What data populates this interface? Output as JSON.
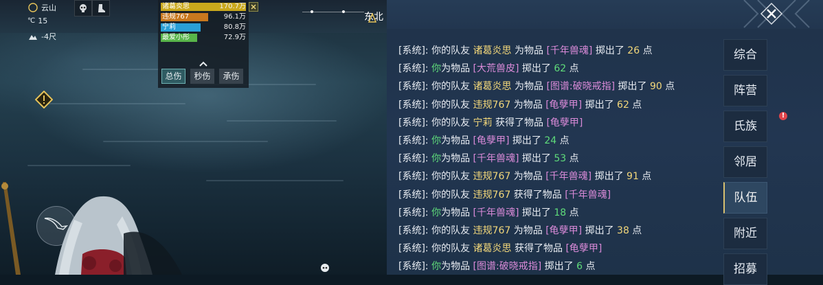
{
  "hud": {
    "weather": "云山",
    "temperature_unit": "℃",
    "temperature": "15",
    "altitude": "-4尺",
    "compass_label": "东北",
    "warning_icon": "warning-diamond-icon"
  },
  "damage_meter": {
    "entries": [
      {
        "name": "诸葛炎思",
        "value": "170.7万",
        "color": "#c9a81c",
        "fill": 1.0
      },
      {
        "name": "违规767",
        "value": "96.1万",
        "color": "#c9781e",
        "fill": 0.56
      },
      {
        "name": "宁莉",
        "value": "80.8万",
        "color": "#2a9fd6",
        "fill": 0.47
      },
      {
        "name": "最爱小彤",
        "value": "72.9万",
        "color": "#58b54a",
        "fill": 0.43
      }
    ],
    "tabs": [
      "总伤",
      "秒伤",
      "承伤"
    ],
    "active_tab": "总伤",
    "close_icon": "close-x-icon",
    "collapse_icon": "chevron-up-icon"
  },
  "chat": {
    "messages": [
      [
        {
          "t": "[系统]: ",
          "c": "sys"
        },
        {
          "t": "你的队友 ",
          "c": "sys"
        },
        {
          "t": "诸葛炎思",
          "c": "name"
        },
        {
          "t": " 为物品 ",
          "c": "sys"
        },
        {
          "t": "[千年兽魂]",
          "c": "item"
        },
        {
          "t": " 掷出了 ",
          "c": "sys"
        },
        {
          "t": "26",
          "c": "num"
        },
        {
          "t": " 点",
          "c": "sys"
        }
      ],
      [
        {
          "t": "[系统]: ",
          "c": "sys"
        },
        {
          "t": "你",
          "c": "you"
        },
        {
          "t": "为物品 ",
          "c": "sys"
        },
        {
          "t": "[大荒兽皮]",
          "c": "item"
        },
        {
          "t": " 掷出了 ",
          "c": "sys"
        },
        {
          "t": "62",
          "c": "you"
        },
        {
          "t": " 点",
          "c": "sys"
        }
      ],
      [
        {
          "t": "[系统]: ",
          "c": "sys"
        },
        {
          "t": "你的队友 ",
          "c": "sys"
        },
        {
          "t": "诸葛炎思",
          "c": "name"
        },
        {
          "t": " 为物品 ",
          "c": "sys"
        },
        {
          "t": "[图谱:破晓戒指]",
          "c": "item"
        },
        {
          "t": " 掷出了 ",
          "c": "sys"
        },
        {
          "t": "90",
          "c": "num"
        },
        {
          "t": " 点",
          "c": "sys"
        }
      ],
      [
        {
          "t": "[系统]: ",
          "c": "sys"
        },
        {
          "t": "你的队友 ",
          "c": "sys"
        },
        {
          "t": "违规767",
          "c": "name"
        },
        {
          "t": " 为物品 ",
          "c": "sys"
        },
        {
          "t": "[龟孽甲]",
          "c": "item"
        },
        {
          "t": " 掷出了 ",
          "c": "sys"
        },
        {
          "t": "62",
          "c": "num"
        },
        {
          "t": " 点",
          "c": "sys"
        }
      ],
      [
        {
          "t": "[系统]: ",
          "c": "sys"
        },
        {
          "t": "你的队友 ",
          "c": "sys"
        },
        {
          "t": "宁莉",
          "c": "name"
        },
        {
          "t": " 获得了物品 ",
          "c": "sys"
        },
        {
          "t": "[龟孽甲]",
          "c": "item"
        }
      ],
      [
        {
          "t": "[系统]: ",
          "c": "sys"
        },
        {
          "t": "你",
          "c": "you"
        },
        {
          "t": "为物品 ",
          "c": "sys"
        },
        {
          "t": "[龟孽甲]",
          "c": "item"
        },
        {
          "t": " 掷出了 ",
          "c": "sys"
        },
        {
          "t": "24",
          "c": "you"
        },
        {
          "t": " 点",
          "c": "sys"
        }
      ],
      [
        {
          "t": "[系统]: ",
          "c": "sys"
        },
        {
          "t": "你",
          "c": "you"
        },
        {
          "t": "为物品 ",
          "c": "sys"
        },
        {
          "t": "[千年兽魂]",
          "c": "item"
        },
        {
          "t": " 掷出了 ",
          "c": "sys"
        },
        {
          "t": "53",
          "c": "you"
        },
        {
          "t": " 点",
          "c": "sys"
        }
      ],
      [
        {
          "t": "[系统]: ",
          "c": "sys"
        },
        {
          "t": "你的队友 ",
          "c": "sys"
        },
        {
          "t": "违规767",
          "c": "name"
        },
        {
          "t": " 为物品 ",
          "c": "sys"
        },
        {
          "t": "[千年兽魂]",
          "c": "item"
        },
        {
          "t": " 掷出了 ",
          "c": "sys"
        },
        {
          "t": "91",
          "c": "num"
        },
        {
          "t": " 点",
          "c": "sys"
        }
      ],
      [
        {
          "t": "[系统]: ",
          "c": "sys"
        },
        {
          "t": "你的队友 ",
          "c": "sys"
        },
        {
          "t": "违规767",
          "c": "name"
        },
        {
          "t": " 获得了物品 ",
          "c": "sys"
        },
        {
          "t": "[千年兽魂]",
          "c": "item"
        }
      ],
      [
        {
          "t": "[系统]: ",
          "c": "sys"
        },
        {
          "t": "你",
          "c": "you"
        },
        {
          "t": "为物品 ",
          "c": "sys"
        },
        {
          "t": "[千年兽魂]",
          "c": "item"
        },
        {
          "t": " 掷出了 ",
          "c": "sys"
        },
        {
          "t": "18",
          "c": "you"
        },
        {
          "t": " 点",
          "c": "sys"
        }
      ],
      [
        {
          "t": "[系统]: ",
          "c": "sys"
        },
        {
          "t": "你的队友 ",
          "c": "sys"
        },
        {
          "t": "违规767",
          "c": "name"
        },
        {
          "t": " 为物品 ",
          "c": "sys"
        },
        {
          "t": "[龟孽甲]",
          "c": "item"
        },
        {
          "t": " 掷出了 ",
          "c": "sys"
        },
        {
          "t": "38",
          "c": "num"
        },
        {
          "t": " 点",
          "c": "sys"
        }
      ],
      [
        {
          "t": "[系统]: ",
          "c": "sys"
        },
        {
          "t": "你的队友 ",
          "c": "sys"
        },
        {
          "t": "诸葛炎思",
          "c": "name"
        },
        {
          "t": " 获得了物品 ",
          "c": "sys"
        },
        {
          "t": "[龟孽甲]",
          "c": "item"
        }
      ],
      [
        {
          "t": "[系统]: ",
          "c": "sys"
        },
        {
          "t": "你",
          "c": "you"
        },
        {
          "t": "为物品 ",
          "c": "sys"
        },
        {
          "t": "[图谱:破晓戒指]",
          "c": "item"
        },
        {
          "t": " 掷出了 ",
          "c": "sys"
        },
        {
          "t": "6",
          "c": "you"
        },
        {
          "t": " 点",
          "c": "sys"
        }
      ]
    ],
    "channels": [
      "综合",
      "阵营",
      "氏族",
      "邻居",
      "队伍",
      "附近",
      "招募"
    ],
    "active_channel": "队伍",
    "alert_badge": "!",
    "close_icon": "close-x-icon"
  }
}
